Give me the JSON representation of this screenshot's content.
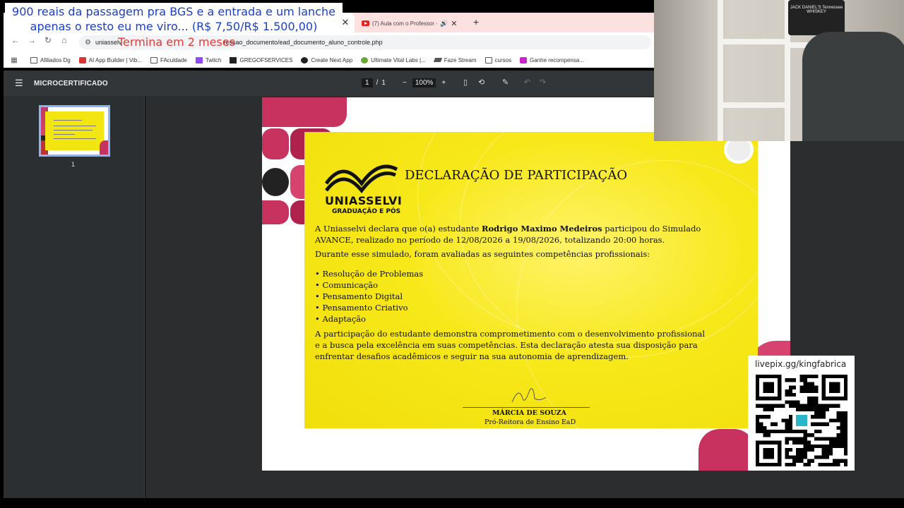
{
  "overlay": {
    "banner_line1": "900 reais da passagem pra BGS e a entrada e um lanche",
    "banner_line2": "apenas o resto eu me viro... (R$ 7,50/R$ 1.500,00)",
    "countdown": "Termina em 2 meses",
    "qr_url": "livepix.gg/kingfabrica"
  },
  "browser": {
    "tab2_title": "(7) Aula com o Professor - I",
    "url_prefix": "uniasselv",
    "url_suffix": "ressao_documento/ead_documento_aluno_controle.php",
    "bookmarks": [
      {
        "label": "Afiliados Dg",
        "icon": "folder"
      },
      {
        "label": "AI App Builder | Vib...",
        "icon": "red"
      },
      {
        "label": "FAculdade",
        "icon": "folder"
      },
      {
        "label": "Twitch",
        "icon": "twitch"
      },
      {
        "label": "GREGOFSERVICES",
        "icon": "black"
      },
      {
        "label": "Create Next App",
        "icon": "circ"
      },
      {
        "label": "Ultimate Vital Labs |...",
        "icon": "green"
      },
      {
        "label": "Faze Stream",
        "icon": "bird"
      },
      {
        "label": "cursos",
        "icon": "folder"
      },
      {
        "label": "Ganhe recompensa...",
        "icon": "pink"
      }
    ]
  },
  "pdf": {
    "title": "MICROCERTIFICADO",
    "current_page": "1",
    "total_pages": "1",
    "zoom": "100%",
    "thumbnail_label": "1"
  },
  "certificate": {
    "logo_name": "UNIASSELVI",
    "logo_sub": "GRADUAÇÃO E PÓS",
    "title": "DECLARAÇÃO DE PARTICIPAÇÃO",
    "p1_before": "A Uniasselvi declara que o(a) estudante ",
    "student_name": "Rodrigo Maximo Medeiros",
    "p1_after": " participou do Simulado AVANCE, realizado no período de 12/08/2026 a 19/08/2026, totalizando 20:00 horas.",
    "p2": "Durante esse simulado, foram avaliadas as seguintes competências profissionais:",
    "skills": [
      "Resolução de Problemas",
      "Comunicação",
      "Pensamento Digital",
      "Pensamento Criativo",
      "Adaptação"
    ],
    "p3": "A participação do estudante demonstra comprometimento com o desenvolvimento profissional e a busca pela excelência em suas competências. Esta declaração atesta sua disposição para enfrentar desafios acadêmicos e seguir na sua autonomia de aprendizagem.",
    "signer_name": "MÁRCIA DE SOUZA",
    "signer_role": "Pró-Reitora de Ensino EaD"
  },
  "webcam": {
    "label_text": "JACK DANIEL'S Tennessee WHISKEY"
  },
  "colors": {
    "cert_yellow": "#f7e81a",
    "accent_magenta": "#c8325f",
    "banner_blue": "#1a3fc6",
    "timer_red": "#e23a3a"
  }
}
